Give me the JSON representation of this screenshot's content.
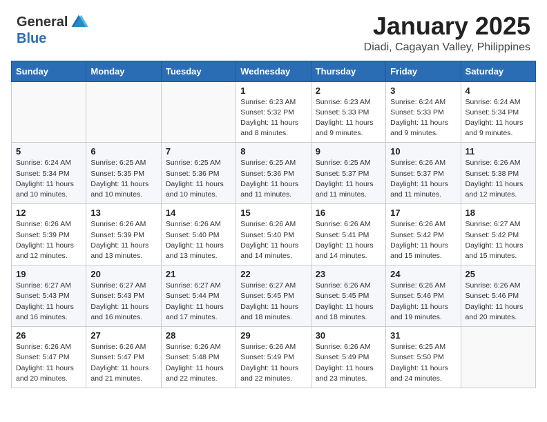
{
  "header": {
    "logo": {
      "general": "General",
      "blue": "Blue"
    },
    "title": "January 2025",
    "location": "Diadi, Cagayan Valley, Philippines"
  },
  "calendar": {
    "days_of_week": [
      "Sunday",
      "Monday",
      "Tuesday",
      "Wednesday",
      "Thursday",
      "Friday",
      "Saturday"
    ],
    "weeks": [
      [
        {
          "day": "",
          "info": ""
        },
        {
          "day": "",
          "info": ""
        },
        {
          "day": "",
          "info": ""
        },
        {
          "day": "1",
          "info": "Sunrise: 6:23 AM\nSunset: 5:32 PM\nDaylight: 11 hours and 8 minutes."
        },
        {
          "day": "2",
          "info": "Sunrise: 6:23 AM\nSunset: 5:33 PM\nDaylight: 11 hours and 9 minutes."
        },
        {
          "day": "3",
          "info": "Sunrise: 6:24 AM\nSunset: 5:33 PM\nDaylight: 11 hours and 9 minutes."
        },
        {
          "day": "4",
          "info": "Sunrise: 6:24 AM\nSunset: 5:34 PM\nDaylight: 11 hours and 9 minutes."
        }
      ],
      [
        {
          "day": "5",
          "info": "Sunrise: 6:24 AM\nSunset: 5:34 PM\nDaylight: 11 hours and 10 minutes."
        },
        {
          "day": "6",
          "info": "Sunrise: 6:25 AM\nSunset: 5:35 PM\nDaylight: 11 hours and 10 minutes."
        },
        {
          "day": "7",
          "info": "Sunrise: 6:25 AM\nSunset: 5:36 PM\nDaylight: 11 hours and 10 minutes."
        },
        {
          "day": "8",
          "info": "Sunrise: 6:25 AM\nSunset: 5:36 PM\nDaylight: 11 hours and 11 minutes."
        },
        {
          "day": "9",
          "info": "Sunrise: 6:25 AM\nSunset: 5:37 PM\nDaylight: 11 hours and 11 minutes."
        },
        {
          "day": "10",
          "info": "Sunrise: 6:26 AM\nSunset: 5:37 PM\nDaylight: 11 hours and 11 minutes."
        },
        {
          "day": "11",
          "info": "Sunrise: 6:26 AM\nSunset: 5:38 PM\nDaylight: 11 hours and 12 minutes."
        }
      ],
      [
        {
          "day": "12",
          "info": "Sunrise: 6:26 AM\nSunset: 5:39 PM\nDaylight: 11 hours and 12 minutes."
        },
        {
          "day": "13",
          "info": "Sunrise: 6:26 AM\nSunset: 5:39 PM\nDaylight: 11 hours and 13 minutes."
        },
        {
          "day": "14",
          "info": "Sunrise: 6:26 AM\nSunset: 5:40 PM\nDaylight: 11 hours and 13 minutes."
        },
        {
          "day": "15",
          "info": "Sunrise: 6:26 AM\nSunset: 5:40 PM\nDaylight: 11 hours and 14 minutes."
        },
        {
          "day": "16",
          "info": "Sunrise: 6:26 AM\nSunset: 5:41 PM\nDaylight: 11 hours and 14 minutes."
        },
        {
          "day": "17",
          "info": "Sunrise: 6:26 AM\nSunset: 5:42 PM\nDaylight: 11 hours and 15 minutes."
        },
        {
          "day": "18",
          "info": "Sunrise: 6:27 AM\nSunset: 5:42 PM\nDaylight: 11 hours and 15 minutes."
        }
      ],
      [
        {
          "day": "19",
          "info": "Sunrise: 6:27 AM\nSunset: 5:43 PM\nDaylight: 11 hours and 16 minutes."
        },
        {
          "day": "20",
          "info": "Sunrise: 6:27 AM\nSunset: 5:43 PM\nDaylight: 11 hours and 16 minutes."
        },
        {
          "day": "21",
          "info": "Sunrise: 6:27 AM\nSunset: 5:44 PM\nDaylight: 11 hours and 17 minutes."
        },
        {
          "day": "22",
          "info": "Sunrise: 6:27 AM\nSunset: 5:45 PM\nDaylight: 11 hours and 18 minutes."
        },
        {
          "day": "23",
          "info": "Sunrise: 6:26 AM\nSunset: 5:45 PM\nDaylight: 11 hours and 18 minutes."
        },
        {
          "day": "24",
          "info": "Sunrise: 6:26 AM\nSunset: 5:46 PM\nDaylight: 11 hours and 19 minutes."
        },
        {
          "day": "25",
          "info": "Sunrise: 6:26 AM\nSunset: 5:46 PM\nDaylight: 11 hours and 20 minutes."
        }
      ],
      [
        {
          "day": "26",
          "info": "Sunrise: 6:26 AM\nSunset: 5:47 PM\nDaylight: 11 hours and 20 minutes."
        },
        {
          "day": "27",
          "info": "Sunrise: 6:26 AM\nSunset: 5:47 PM\nDaylight: 11 hours and 21 minutes."
        },
        {
          "day": "28",
          "info": "Sunrise: 6:26 AM\nSunset: 5:48 PM\nDaylight: 11 hours and 22 minutes."
        },
        {
          "day": "29",
          "info": "Sunrise: 6:26 AM\nSunset: 5:49 PM\nDaylight: 11 hours and 22 minutes."
        },
        {
          "day": "30",
          "info": "Sunrise: 6:26 AM\nSunset: 5:49 PM\nDaylight: 11 hours and 23 minutes."
        },
        {
          "day": "31",
          "info": "Sunrise: 6:25 AM\nSunset: 5:50 PM\nDaylight: 11 hours and 24 minutes."
        },
        {
          "day": "",
          "info": ""
        }
      ]
    ]
  }
}
